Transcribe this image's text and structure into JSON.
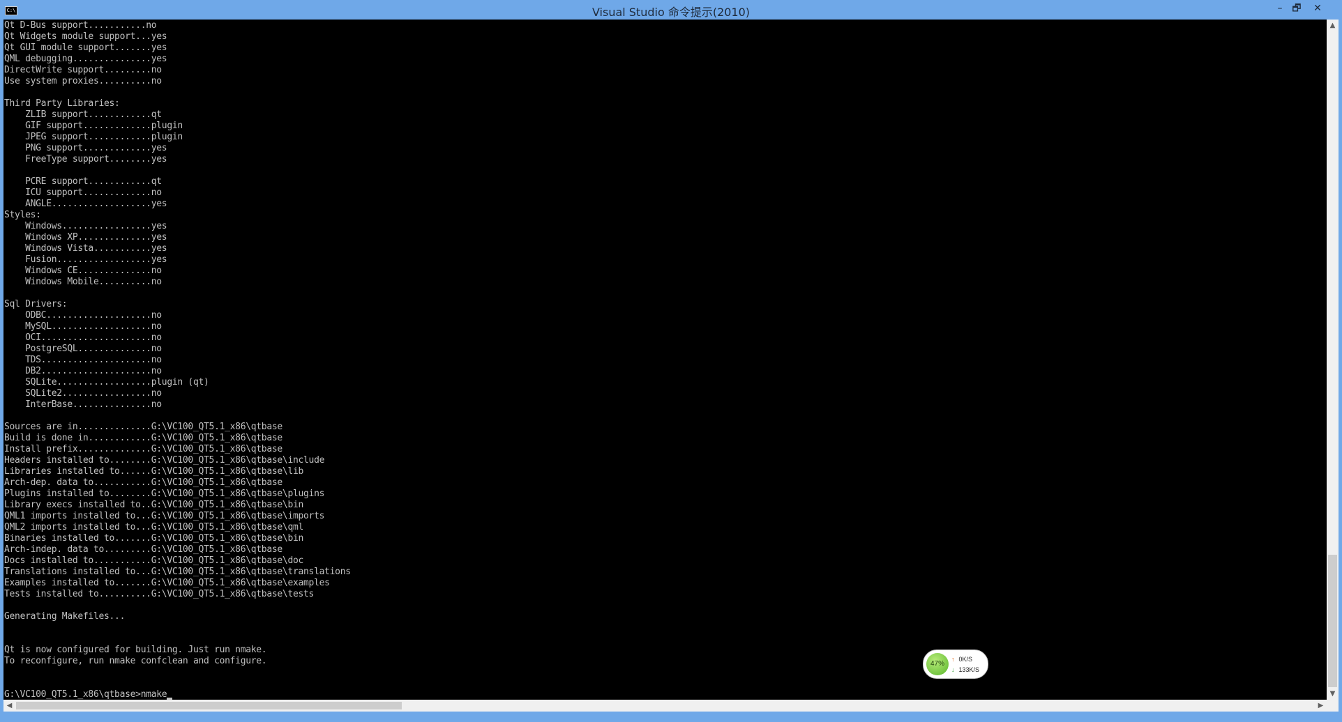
{
  "window": {
    "title": "Visual Studio 命令提示(2010)",
    "icon_label": "C:\\",
    "buttons": {
      "minimize": "–",
      "maximize": "🗗",
      "close": "✕"
    }
  },
  "console": {
    "lines": [
      "Qt D-Bus support...........no",
      "Qt Widgets module support...yes",
      "Qt GUI module support.......yes",
      "QML debugging...............yes",
      "DirectWrite support.........no",
      "Use system proxies..........no",
      "",
      "Third Party Libraries:",
      "    ZLIB support............qt",
      "    GIF support.............plugin",
      "    JPEG support............plugin",
      "    PNG support.............yes",
      "    FreeType support........yes",
      "",
      "    PCRE support............qt",
      "    ICU support.............no",
      "    ANGLE...................yes",
      "Styles:",
      "    Windows.................yes",
      "    Windows XP..............yes",
      "    Windows Vista...........yes",
      "    Fusion..................yes",
      "    Windows CE..............no",
      "    Windows Mobile..........no",
      "",
      "Sql Drivers:",
      "    ODBC....................no",
      "    MySQL...................no",
      "    OCI.....................no",
      "    PostgreSQL..............no",
      "    TDS.....................no",
      "    DB2.....................no",
      "    SQLite..................plugin (qt)",
      "    SQLite2.................no",
      "    InterBase...............no",
      "",
      "Sources are in..............G:\\VC100_QT5.1_x86\\qtbase",
      "Build is done in............G:\\VC100_QT5.1_x86\\qtbase",
      "Install prefix..............G:\\VC100_QT5.1_x86\\qtbase",
      "Headers installed to........G:\\VC100_QT5.1_x86\\qtbase\\include",
      "Libraries installed to......G:\\VC100_QT5.1_x86\\qtbase\\lib",
      "Arch-dep. data to...........G:\\VC100_QT5.1_x86\\qtbase",
      "Plugins installed to........G:\\VC100_QT5.1_x86\\qtbase\\plugins",
      "Library execs installed to..G:\\VC100_QT5.1_x86\\qtbase\\bin",
      "QML1 imports installed to...G:\\VC100_QT5.1_x86\\qtbase\\imports",
      "QML2 imports installed to...G:\\VC100_QT5.1_x86\\qtbase\\qml",
      "Binaries installed to.......G:\\VC100_QT5.1_x86\\qtbase\\bin",
      "Arch-indep. data to.........G:\\VC100_QT5.1_x86\\qtbase",
      "Docs installed to...........G:\\VC100_QT5.1_x86\\qtbase\\doc",
      "Translations installed to...G:\\VC100_QT5.1_x86\\qtbase\\translations",
      "Examples installed to.......G:\\VC100_QT5.1_x86\\qtbase\\examples",
      "Tests installed to..........G:\\VC100_QT5.1_x86\\qtbase\\tests",
      "",
      "Generating Makefiles...",
      "",
      "",
      "Qt is now configured for building. Just run nmake.",
      "To reconfigure, run nmake confclean and configure.",
      "",
      "",
      "G:\\VC100_QT5.1_x86\\qtbase>nmake"
    ]
  },
  "scrollbars": {
    "up_arrow": "▲",
    "down_arrow": "▼",
    "left_arrow": "◀",
    "right_arrow": "▶"
  },
  "net_monitor": {
    "cpu_percent_label": "47%",
    "upload_arrow": "↑",
    "upload_speed": "0K/S",
    "download_arrow": "↓",
    "download_speed": "133K/S"
  }
}
